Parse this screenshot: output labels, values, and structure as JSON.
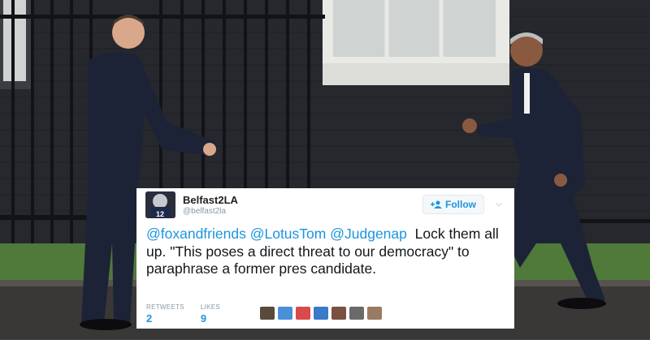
{
  "tweet": {
    "display_name": "Belfast2LA",
    "handle": "@belfast2la",
    "follow_label": "Follow",
    "mentions": [
      "@foxandfriends",
      "@LotusTom",
      "@Judgenap"
    ],
    "text_rest": "Lock them all up. \"This poses a direct threat to our democracy\" to paraphrase a former pres candidate.",
    "retweets_label": "RETWEETS",
    "retweets": "2",
    "likes_label": "LIKES",
    "likes": "9",
    "avatar_number": "12"
  },
  "colors": {
    "link": "#1b95e0",
    "text": "#14171a",
    "muted": "#8899a6"
  },
  "icons": {
    "follow": "add-user-icon",
    "caret": "chevron-down-icon"
  }
}
